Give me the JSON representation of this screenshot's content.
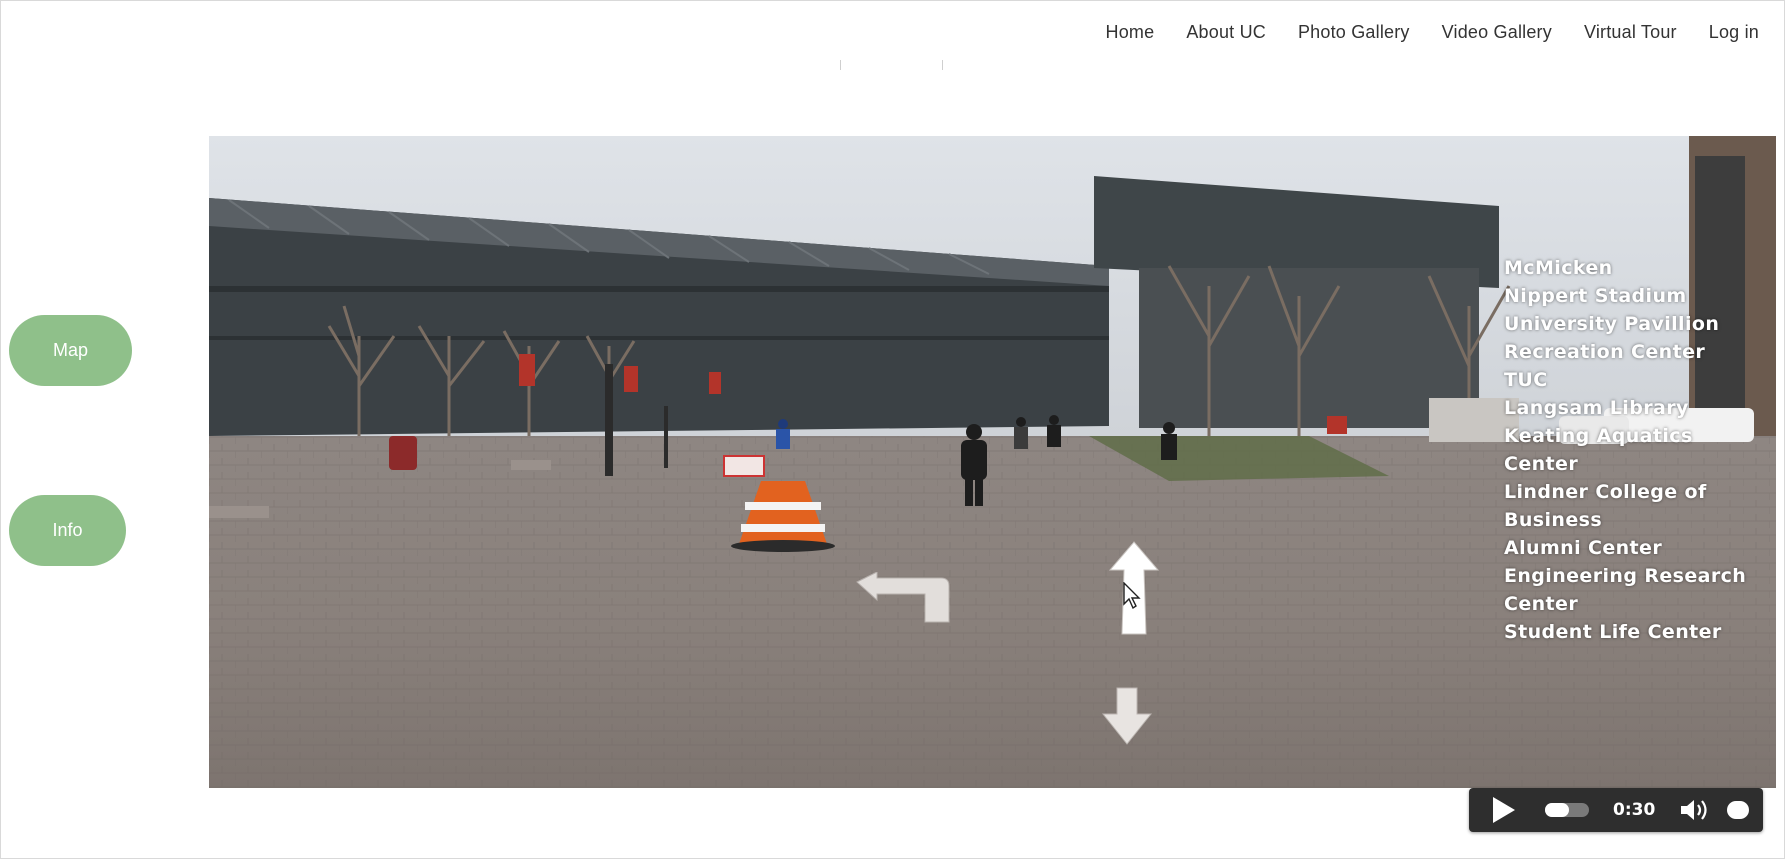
{
  "nav": {
    "items": [
      "Home",
      "About UC",
      "Photo Gallery",
      "Video Gallery",
      "Virtual Tour",
      "Log in"
    ]
  },
  "side": {
    "map_label": "Map",
    "info_label": "Info",
    "button_color": "#8fc08a"
  },
  "places": [
    "McMicken",
    "Nippert Stadium",
    "University Pavillion",
    "Recreation Center",
    "TUC",
    "Langsam Library",
    "Keating Aquatics",
    "Center",
    "Lindner College of",
    "Business",
    "Alumni Center",
    "Engineering Research",
    "Center",
    "Student Life Center"
  ],
  "arrows": [
    "turn-left-arrow-icon",
    "forward-arrow-icon",
    "back-arrow-icon"
  ],
  "player": {
    "time": "0:30",
    "progress": 0.55,
    "icons": [
      "play-icon",
      "volume-icon"
    ]
  }
}
